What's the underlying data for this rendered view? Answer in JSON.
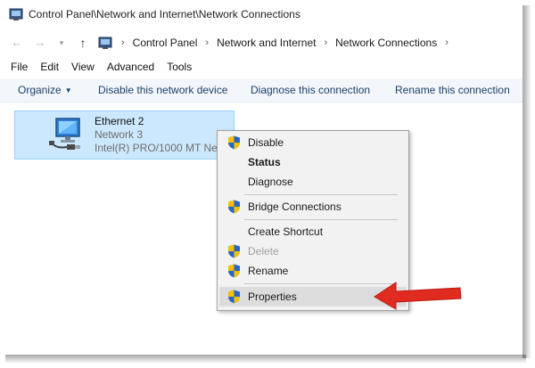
{
  "window": {
    "title": "Control Panel\\Network and Internet\\Network Connections",
    "app_icon": "control-panel-icon"
  },
  "address_bar": {
    "breadcrumbs": [
      "Control Panel",
      "Network and Internet",
      "Network Connections"
    ],
    "separator": "›"
  },
  "menu": [
    "File",
    "Edit",
    "View",
    "Advanced",
    "Tools"
  ],
  "toolbar": {
    "organize": "Organize",
    "disable": "Disable this network device",
    "diagnose": "Diagnose this connection",
    "rename": "Rename this connection"
  },
  "connection": {
    "name": "Ethernet 2",
    "network": "Network  3",
    "adapter": "Intel(R) PRO/1000 MT Net...",
    "icon": "network-adapter-icon",
    "selected": true
  },
  "context_menu": {
    "items": [
      {
        "label": "Disable",
        "shield": true,
        "style": "normal"
      },
      {
        "label": "Status",
        "shield": false,
        "style": "bold"
      },
      {
        "label": "Diagnose",
        "shield": false,
        "style": "normal"
      },
      {
        "label": "Bridge Connections",
        "shield": true,
        "style": "normal"
      },
      {
        "label": "Create Shortcut",
        "shield": false,
        "style": "normal"
      },
      {
        "label": "Delete",
        "shield": true,
        "style": "disabled"
      },
      {
        "label": "Rename",
        "shield": true,
        "style": "normal"
      },
      {
        "label": "Properties",
        "shield": true,
        "style": "highlighted"
      }
    ]
  },
  "colors": {
    "selection_fill": "#cce8ff",
    "selection_border": "#99d1ff",
    "toolbar_text": "#1c3f6b",
    "arrow": "#e02b20",
    "shield_blue": "#2a64c5",
    "shield_yellow": "#f2c200"
  }
}
